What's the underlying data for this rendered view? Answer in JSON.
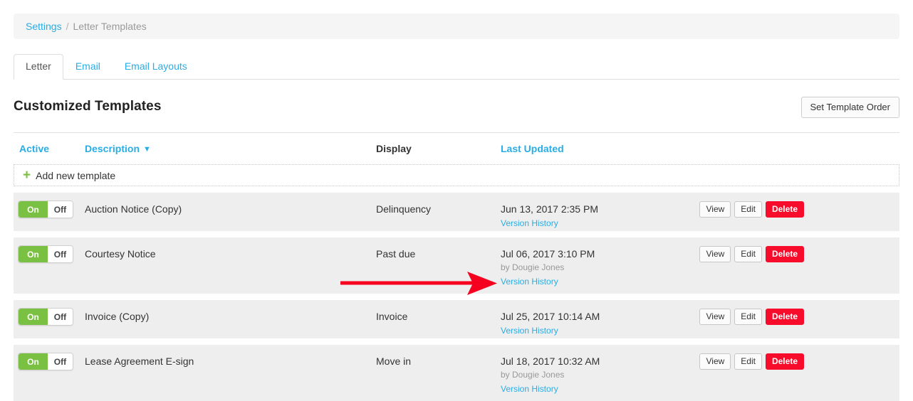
{
  "breadcrumb": {
    "parent": "Settings",
    "separator": "/",
    "current": "Letter Templates"
  },
  "tabs": [
    {
      "label": "Letter",
      "active": true
    },
    {
      "label": "Email",
      "active": false
    },
    {
      "label": "Email Layouts",
      "active": false
    }
  ],
  "page": {
    "title": "Customized Templates",
    "set_order_button": "Set Template Order"
  },
  "table": {
    "columns": {
      "active": "Active",
      "description": "Description",
      "display": "Display",
      "last_updated": "Last Updated",
      "sort_caret": "⌄"
    },
    "add_row": {
      "icon": "plus-icon",
      "glyph": "+",
      "label": "Add new template"
    },
    "actions": {
      "view": "View",
      "edit": "Edit",
      "delete": "Delete"
    },
    "toggle": {
      "on": "On",
      "off": "Off"
    },
    "version_history_label": "Version History",
    "rows": [
      {
        "active": true,
        "description": "Auction Notice (Copy)",
        "display": "Delinquency",
        "updated": "Jun 13, 2017 2:35 PM",
        "by": "",
        "version_history": "Version History"
      },
      {
        "active": true,
        "description": "Courtesy Notice",
        "display": "Past due",
        "updated": "Jul 06, 2017 3:10 PM",
        "by": "by Dougie Jones",
        "version_history": "Version History"
      },
      {
        "active": true,
        "description": "Invoice (Copy)",
        "display": "Invoice",
        "updated": "Jul 25, 2017 10:14 AM",
        "by": "",
        "version_history": "Version History"
      },
      {
        "active": true,
        "description": "Lease Agreement E-sign",
        "display": "Move in",
        "updated": "Jul 18, 2017 10:32 AM",
        "by": "by Dougie Jones",
        "version_history": "Version History"
      }
    ]
  },
  "annotation": {
    "type": "arrow",
    "color": "#f5001e",
    "points_to": "Version History"
  },
  "colors": {
    "link": "#29ade4",
    "toggle_on": "#7ac143",
    "delete": "#f70d2b",
    "row_bg": "#eeeeee",
    "breadcrumb_bg": "#f5f5f5"
  }
}
